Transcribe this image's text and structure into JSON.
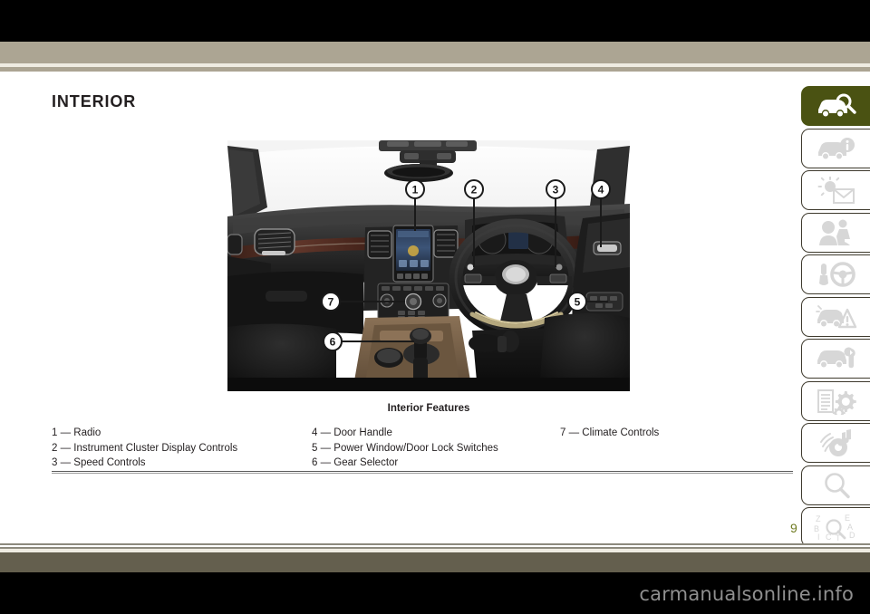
{
  "document": {
    "title": "INTERIOR",
    "page_number": "9",
    "watermark": "carmanualsonline.info"
  },
  "figure": {
    "caption": "Interior Features",
    "alt_description": "Right-hand-drive vehicle interior dashboard view with numbered callouts",
    "callouts": [
      {
        "number": "1",
        "target": "Radio"
      },
      {
        "number": "2",
        "target": "Instrument Cluster Display Controls"
      },
      {
        "number": "3",
        "target": "Speed Controls"
      },
      {
        "number": "4",
        "target": "Door Handle"
      },
      {
        "number": "5",
        "target": "Power Window/Door Lock Switches"
      },
      {
        "number": "6",
        "target": "Gear Selector"
      },
      {
        "number": "7",
        "target": "Climate Controls"
      }
    ]
  },
  "legend": {
    "column1": [
      "1 — Radio",
      "2 — Instrument Cluster Display Controls",
      "3 — Speed Controls"
    ],
    "column2": [
      "4 — Door Handle",
      "5 — Power Window/Door Lock Switches",
      "6 — Gear Selector"
    ],
    "column3": [
      "7 — Climate Controls"
    ]
  },
  "sidebar": {
    "active_index": 0,
    "tabs": [
      {
        "icon": "car-magnifier-icon",
        "label": "Introduction",
        "active": true
      },
      {
        "icon": "car-info-icon",
        "label": "Getting To Know Your Vehicle",
        "active": false
      },
      {
        "icon": "dashboard-lights-mail-icon",
        "label": "Getting To Know Your Instrument Panel",
        "active": false
      },
      {
        "icon": "occupant-safety-icon",
        "label": "Safety",
        "active": false
      },
      {
        "icon": "key-steering-wheel-icon",
        "label": "Starting And Operating",
        "active": false
      },
      {
        "icon": "car-warning-triangle-icon",
        "label": "What To Do In Emergencies",
        "active": false
      },
      {
        "icon": "car-wrench-icon",
        "label": "Servicing And Maintenance",
        "active": false
      },
      {
        "icon": "list-gears-icon",
        "label": "Technical Specifications",
        "active": false
      },
      {
        "icon": "multimedia-note-icon",
        "label": "Multimedia",
        "active": false
      },
      {
        "icon": "magnifier-icon",
        "label": "Contents",
        "active": false
      },
      {
        "icon": "alphabet-index-icon",
        "label": "Index",
        "active": false
      }
    ],
    "index_letters": [
      "Z",
      "E",
      "B",
      "A",
      "I",
      "C",
      "T",
      "D"
    ]
  },
  "colors": {
    "accent_olive": "#4a5212",
    "band_beige": "#aca593",
    "band_cream": "#efece2",
    "band_olive_dark": "#645f4e",
    "text": "#231f20",
    "page_number": "#6f7a21"
  }
}
